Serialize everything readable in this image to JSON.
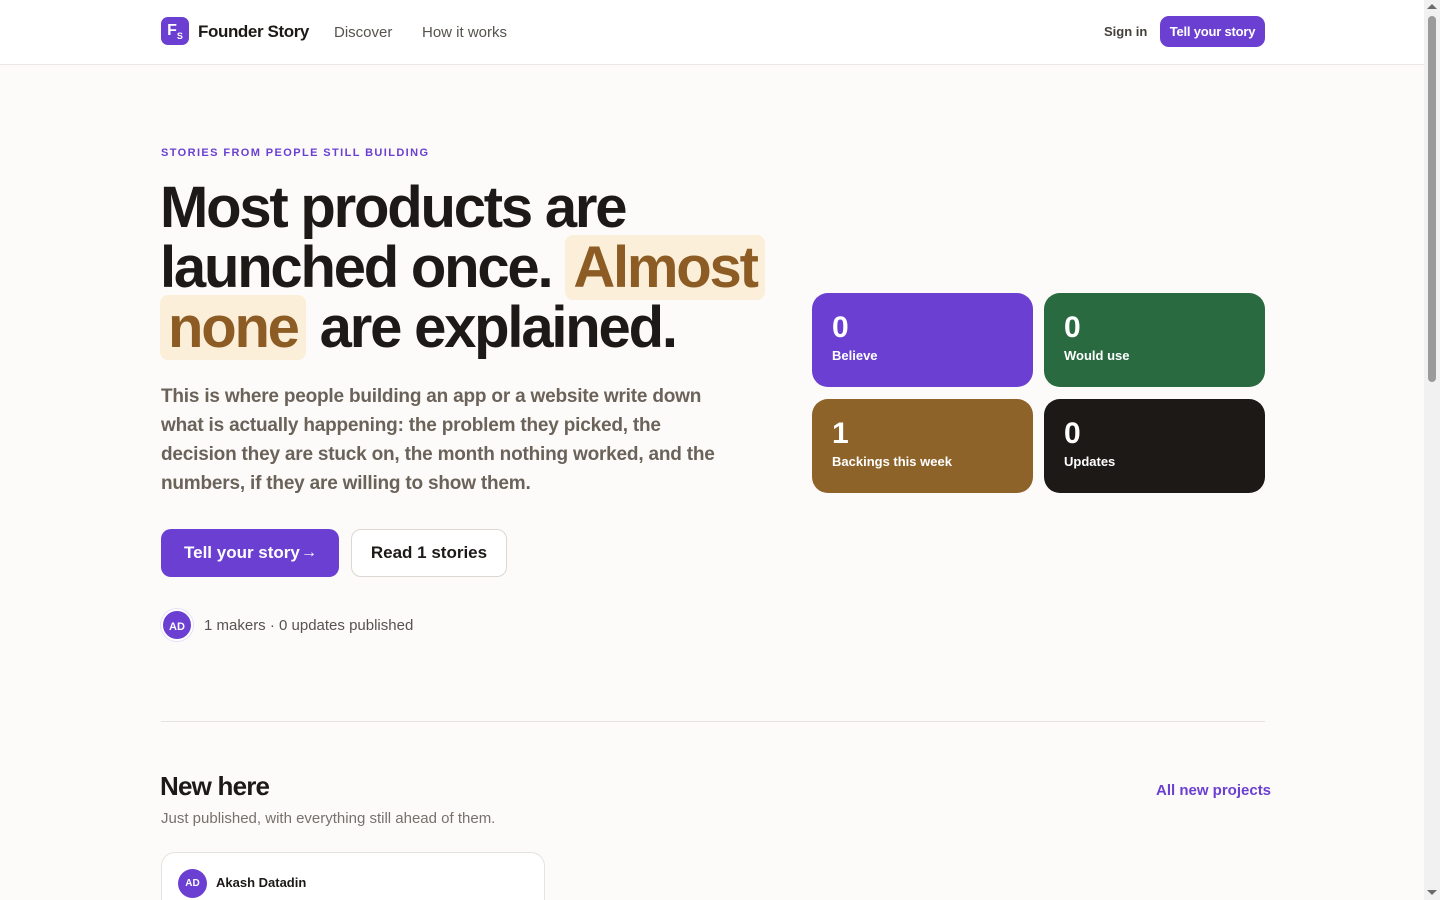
{
  "header": {
    "logo_letter": "F",
    "logo_sub": "S",
    "brand": "Founder Story",
    "nav": [
      "Discover",
      "How it works"
    ],
    "signin": "Sign in",
    "cta": "Tell your story"
  },
  "hero": {
    "eyebrow": "STORIES FROM PEOPLE STILL BUILDING",
    "title_part1": "Most products are launched once.",
    "title_highlight1": "Almost",
    "title_highlight2": "none",
    "title_part2": "are explained.",
    "description": "This is where people building an app or a website write down what is actually happening: the problem they picked, the decision they are stuck on, the month nothing worked, and the numbers, if they are willing to show them.",
    "primary_button": "Tell your story",
    "primary_arrow": "→",
    "secondary_button": "Read 1 stories",
    "maker_initials": "AD",
    "maker_stats": "1 makers · 0 updates published"
  },
  "stats": [
    {
      "value": "0",
      "label": "Believe"
    },
    {
      "value": "0",
      "label": "Would use"
    },
    {
      "value": "1",
      "label": "Backings this week"
    },
    {
      "value": "0",
      "label": "Updates"
    }
  ],
  "new_here": {
    "title": "New here",
    "subtitle": "Just published, with everything still ahead of them.",
    "link": "All new projects",
    "card": {
      "initials": "AD",
      "name": "Akash Datadin"
    }
  },
  "colors": {
    "accent": "#6a3fd1",
    "green": "#2a6a41",
    "brown": "#8d632a",
    "dark": "#1c1917",
    "highlight_bg": "#fcefd9",
    "highlight_text": "#8c5c24"
  }
}
